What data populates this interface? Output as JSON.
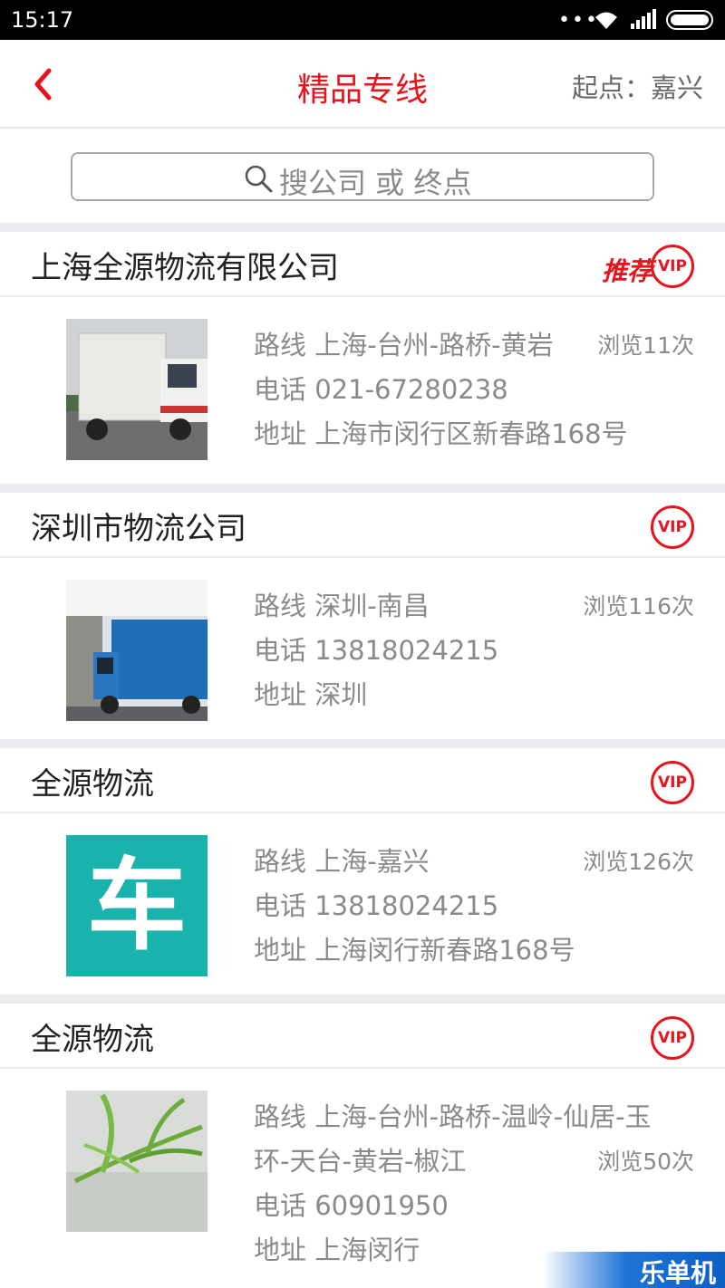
{
  "status_bar": {
    "time": "15:17",
    "dots": "•••"
  },
  "header": {
    "title": "精品专线",
    "origin": "起点：嘉兴"
  },
  "search": {
    "placeholder": "搜公司 或 终点"
  },
  "colors": {
    "accent": "#e8141c",
    "text_gray": "#8a8a8a",
    "divider": "#ececf0"
  },
  "cards": [
    {
      "company": "上海全源物流有限公司",
      "recommend": "推荐",
      "vip": "VIP",
      "image": "truck-white-photo",
      "route": "路线 上海-台州-路桥-黄岩",
      "views": "浏览11次",
      "phone": "电话 021-67280238",
      "address": "地址 上海市闵行区新春路168号"
    },
    {
      "company": "深圳市物流公司",
      "vip": "VIP",
      "image": "truck-blue-photo",
      "route": "路线 深圳-南昌",
      "views": "浏览116次",
      "phone": "电话 13818024215",
      "address": "地址 深圳"
    },
    {
      "company": "全源物流",
      "vip": "VIP",
      "image": "car-logo",
      "image_text": "车",
      "route": "路线 上海-嘉兴",
      "views": "浏览126次",
      "phone": "电话 13818024215",
      "address": "地址 上海闵行新春路168号"
    },
    {
      "company": "全源物流",
      "vip": "VIP",
      "image": "plant-photo",
      "route_line1": "路线 上海-台州-路桥-温岭-仙居-玉",
      "route_line2": "环-天台-黄岩-椒江",
      "views": "浏览50次",
      "phone": "电话 60901950",
      "address": "地址 上海闵行"
    }
  ],
  "watermark": "乐单机"
}
